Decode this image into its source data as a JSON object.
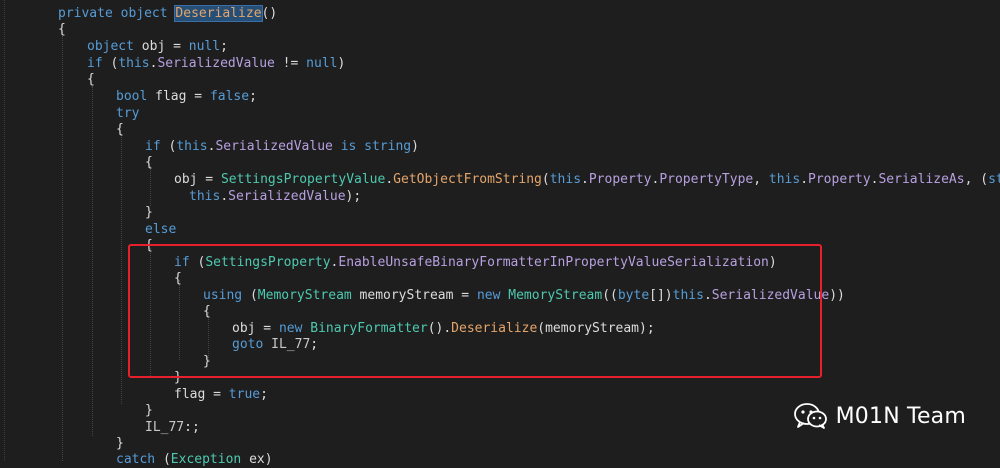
{
  "editor": {
    "lines": [
      {
        "tokens": [
          [
            "kw",
            "private "
          ],
          [
            "kw",
            "object "
          ],
          [
            "hl",
            "Deserialize"
          ],
          [
            "plain",
            "()"
          ]
        ]
      },
      {
        "tokens": [
          [
            "plain",
            "{"
          ]
        ]
      },
      {
        "tokens": [
          [
            "kw",
            "object "
          ],
          [
            "plain",
            "obj = "
          ],
          [
            "kw",
            "null"
          ],
          [
            "plain",
            ";"
          ]
        ]
      },
      {
        "tokens": [
          [
            "kw",
            "if "
          ],
          [
            "plain",
            "("
          ],
          [
            "kw",
            "this"
          ],
          [
            "plain",
            "."
          ],
          [
            "mem",
            "SerializedValue"
          ],
          [
            "plain",
            " != "
          ],
          [
            "kw",
            "null"
          ],
          [
            "plain",
            ")"
          ]
        ]
      },
      {
        "tokens": [
          [
            "plain",
            "{"
          ]
        ]
      },
      {
        "tokens": [
          [
            "kw",
            "bool "
          ],
          [
            "plain",
            "flag = "
          ],
          [
            "kw",
            "false"
          ],
          [
            "plain",
            ";"
          ]
        ]
      },
      {
        "tokens": [
          [
            "kw",
            "try"
          ]
        ]
      },
      {
        "tokens": [
          [
            "plain",
            "{"
          ]
        ]
      },
      {
        "tokens": [
          [
            "kw",
            "if "
          ],
          [
            "plain",
            "("
          ],
          [
            "kw",
            "this"
          ],
          [
            "plain",
            "."
          ],
          [
            "mem",
            "SerializedValue"
          ],
          [
            "plain",
            " "
          ],
          [
            "kw",
            "is "
          ],
          [
            "kw",
            "string"
          ],
          [
            "plain",
            ")"
          ]
        ]
      },
      {
        "tokens": [
          [
            "plain",
            "{"
          ]
        ]
      },
      {
        "tokens": [
          [
            "plain",
            "obj = "
          ],
          [
            "ty",
            "SettingsPropertyValue"
          ],
          [
            "plain",
            "."
          ],
          [
            "meth",
            "GetObjectFromString"
          ],
          [
            "plain",
            "("
          ],
          [
            "kw",
            "this"
          ],
          [
            "plain",
            "."
          ],
          [
            "mem",
            "Property"
          ],
          [
            "plain",
            "."
          ],
          [
            "mem",
            "PropertyType"
          ],
          [
            "plain",
            ", "
          ],
          [
            "kw",
            "this"
          ],
          [
            "plain",
            "."
          ],
          [
            "mem",
            "Property"
          ],
          [
            "plain",
            "."
          ],
          [
            "mem",
            "SerializeAs"
          ],
          [
            "plain",
            ", ("
          ],
          [
            "kw",
            "string"
          ],
          [
            "plain",
            ")"
          ]
        ]
      },
      {
        "tokens": [
          [
            "kw",
            "this"
          ],
          [
            "plain",
            "."
          ],
          [
            "mem",
            "SerializedValue"
          ],
          [
            "plain",
            ");"
          ]
        ]
      },
      {
        "tokens": [
          [
            "plain",
            "}"
          ]
        ]
      },
      {
        "tokens": [
          [
            "kw",
            "else"
          ]
        ]
      },
      {
        "tokens": [
          [
            "plain",
            "{"
          ]
        ]
      },
      {
        "tokens": [
          [
            "kw",
            "if "
          ],
          [
            "plain",
            "("
          ],
          [
            "ty",
            "SettingsProperty"
          ],
          [
            "plain",
            "."
          ],
          [
            "mem",
            "EnableUnsafeBinaryFormatterInPropertyValueSerialization"
          ],
          [
            "plain",
            ")"
          ]
        ]
      },
      {
        "tokens": [
          [
            "plain",
            "{"
          ]
        ]
      },
      {
        "tokens": [
          [
            "kw",
            "using "
          ],
          [
            "plain",
            "("
          ],
          [
            "ty",
            "MemoryStream"
          ],
          [
            "plain",
            " memoryStream = "
          ],
          [
            "kw",
            "new "
          ],
          [
            "ty",
            "MemoryStream"
          ],
          [
            "plain",
            "(("
          ],
          [
            "kw",
            "byte"
          ],
          [
            "plain",
            "[])"
          ],
          [
            "kw",
            "this"
          ],
          [
            "plain",
            "."
          ],
          [
            "mem",
            "SerializedValue"
          ],
          [
            "plain",
            "))"
          ]
        ]
      },
      {
        "tokens": [
          [
            "plain",
            "{"
          ]
        ]
      },
      {
        "tokens": [
          [
            "plain",
            "obj = "
          ],
          [
            "kw",
            "new "
          ],
          [
            "ty",
            "BinaryFormatter"
          ],
          [
            "plain",
            "()."
          ],
          [
            "meth",
            "Deserialize"
          ],
          [
            "plain",
            "(memoryStream);"
          ]
        ]
      },
      {
        "tokens": [
          [
            "kw",
            "goto "
          ],
          [
            "lbl",
            "IL_77"
          ],
          [
            "plain",
            ";"
          ]
        ]
      },
      {
        "tokens": [
          [
            "plain",
            "}"
          ]
        ]
      },
      {
        "tokens": [
          [
            "plain",
            "}"
          ]
        ]
      },
      {
        "tokens": [
          [
            "plain",
            "flag = "
          ],
          [
            "kw",
            "true"
          ],
          [
            "plain",
            ";"
          ]
        ]
      },
      {
        "tokens": [
          [
            "plain",
            "}"
          ]
        ]
      },
      {
        "tokens": [
          [
            "lbl",
            "IL_77"
          ],
          [
            "plain",
            ":;"
          ]
        ]
      },
      {
        "tokens": [
          [
            "plain",
            "}"
          ]
        ]
      },
      {
        "tokens": [
          [
            "kw",
            "catch "
          ],
          [
            "plain",
            "("
          ],
          [
            "ty",
            "Exception"
          ],
          [
            "plain",
            " ex)"
          ]
        ]
      }
    ]
  },
  "watermark": {
    "text": "M01N Team",
    "icon": "wechat-icon"
  },
  "colors": {
    "background": "#1e1e1e",
    "keyword": "#569cd6",
    "type": "#4ec9b0",
    "member": "#b8a0e0",
    "method": "#e5a56a",
    "highlight_box": "#e8202c"
  }
}
